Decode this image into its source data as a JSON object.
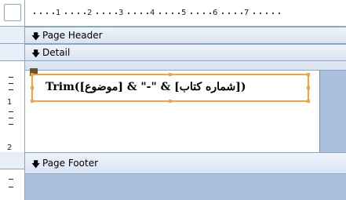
{
  "ruler": {
    "labels": [
      "1",
      "2",
      "3",
      "4",
      "5",
      "6",
      "7"
    ]
  },
  "vruler": {
    "labels": [
      "1",
      "2"
    ]
  },
  "sections": {
    "page_header": "Page Header",
    "detail": "Detail",
    "page_footer": "Page Footer"
  },
  "control": {
    "expression": "Trim([موضوع] & \"-\" & [شماره کتاب])"
  },
  "colors": {
    "selection": "#f0a440",
    "section_bg": "#d9e4f2",
    "report_blue": "#a9bfdd"
  },
  "icons": {
    "section_selector": "arrow-down-icon"
  }
}
